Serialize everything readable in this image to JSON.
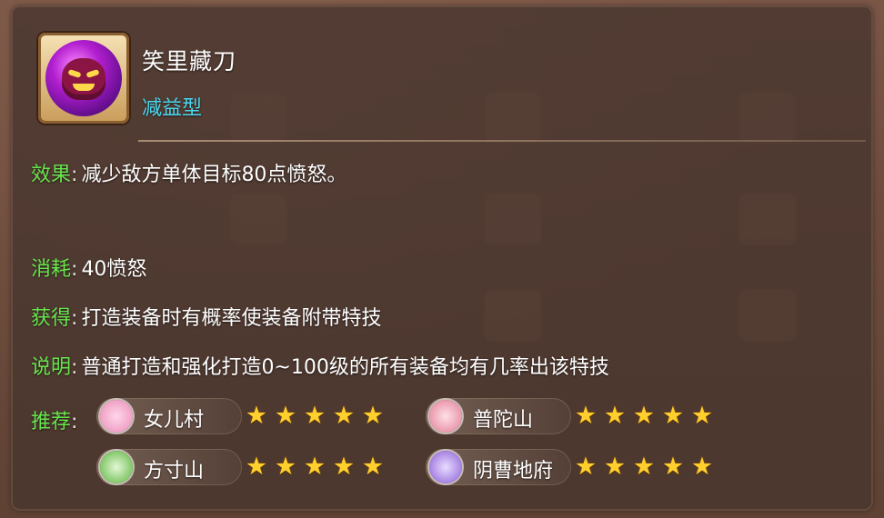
{
  "skill": {
    "name": "笑里藏刀",
    "type": "减益型",
    "icon": "laughing-mask-icon"
  },
  "details": {
    "effect": {
      "label": "效果",
      "sep": ":",
      "value": "减少敌方单体目标80点愤怒。"
    },
    "cost": {
      "label": "消耗",
      "sep": ":",
      "value": "40愤怒"
    },
    "obtain": {
      "label": "获得",
      "sep": ":",
      "value": "打造装备时有概率使装备附带特技"
    },
    "note": {
      "label": "说明",
      "sep": ":",
      "value": "普通打造和强化打造0~100级的所有装备均有几率出该特技"
    },
    "recommend": {
      "label": "推荐",
      "sep": ":"
    }
  },
  "recommendations": [
    {
      "name": "女儿村",
      "icon": "flower-icon",
      "stars": 5,
      "color": "#e88bb5"
    },
    {
      "name": "普陀山",
      "icon": "lotus-icon",
      "stars": 5,
      "color": "#e07a92"
    },
    {
      "name": "方寸山",
      "icon": "leaf-icon",
      "stars": 5,
      "color": "#58b33a"
    },
    {
      "name": "阴曹地府",
      "icon": "ghost-face-icon",
      "stars": 5,
      "color": "#8a5bd6"
    }
  ],
  "colors": {
    "label": "#67e44d",
    "type": "#4ad7f0",
    "star": "#ffcf2e"
  }
}
